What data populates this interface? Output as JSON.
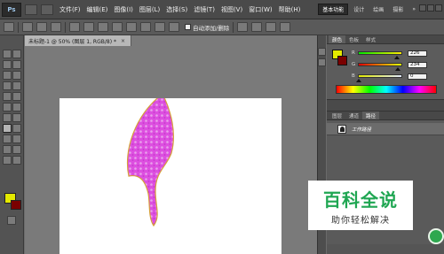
{
  "app": {
    "logo": "Ps",
    "zoom_menu": "50%"
  },
  "menubar": {
    "items": [
      "文件(F)",
      "编辑(E)",
      "图像(I)",
      "图层(L)",
      "选择(S)",
      "滤镜(T)",
      "视图(V)",
      "窗口(W)",
      "帮助(H)"
    ]
  },
  "workspace": {
    "buttons": [
      "基本功能",
      "设计",
      "绘画",
      "摄影"
    ],
    "active": "基本功能",
    "more": "»"
  },
  "options_bar": {
    "auto_add_delete_label": "自动添加/删除",
    "auto_add_delete_checked": false
  },
  "document": {
    "tab_title": "未标题-1 @ 50% (图层 1, RGB/8) *",
    "close_glyph": "×",
    "shape_fill_color": "#dd4fe0",
    "shape_stroke_color": "#d6a13a"
  },
  "colors": {
    "foreground": "#e4ea00",
    "background": "#7a0000"
  },
  "color_panel": {
    "tabs": [
      "颜色",
      "色板",
      "样式"
    ],
    "active_tab": "颜色",
    "sliders": [
      {
        "label": "R",
        "value": "226",
        "fraction": 0.886
      },
      {
        "label": "G",
        "value": "234",
        "fraction": 0.918
      },
      {
        "label": "B",
        "value": "0",
        "fraction": 0.0
      }
    ]
  },
  "paths_panel": {
    "tabs": [
      "图层",
      "通道",
      "路径"
    ],
    "active_tab": "路径",
    "items": [
      {
        "name": "工作路径",
        "icon": "path-thumbnail-icon"
      }
    ]
  },
  "watermark": {
    "title": "百科全说",
    "subtitle": "助你轻松解决"
  }
}
